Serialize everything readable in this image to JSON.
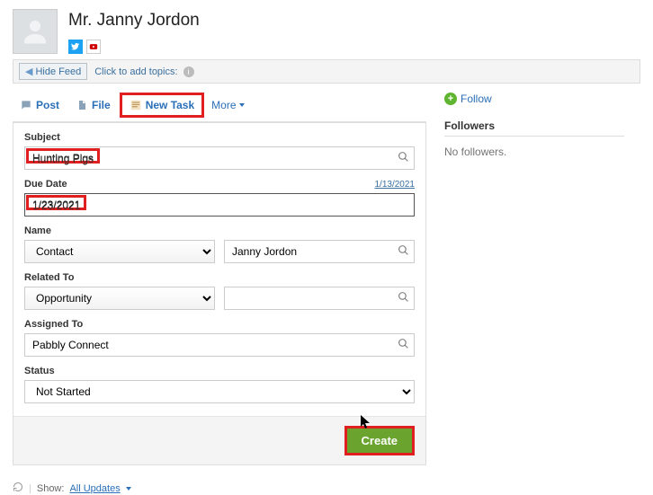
{
  "header": {
    "title": "Mr. Janny Jordon"
  },
  "topicsBar": {
    "hideFeed": "Hide Feed",
    "addTopics": "Click to add topics:"
  },
  "tabs": {
    "post": "Post",
    "file": "File",
    "newTask": "New Task",
    "more": "More"
  },
  "form": {
    "subject": {
      "label": "Subject",
      "value": "Hunting Pigs"
    },
    "dueDate": {
      "label": "Due Date",
      "value": "1/23/2021",
      "hint": "1/13/2021"
    },
    "name": {
      "label": "Name",
      "type": "Contact",
      "value": "Janny Jordon"
    },
    "relatedTo": {
      "label": "Related To",
      "type": "Opportunity",
      "value": ""
    },
    "assignedTo": {
      "label": "Assigned To",
      "value": "Pabbly Connect"
    },
    "status": {
      "label": "Status",
      "value": "Not Started"
    },
    "createBtn": "Create"
  },
  "sidebar": {
    "follow": "Follow",
    "followersHeading": "Followers",
    "noFollowers": "No followers."
  },
  "bottom": {
    "show": "Show:",
    "allUpdates": "All Updates"
  }
}
